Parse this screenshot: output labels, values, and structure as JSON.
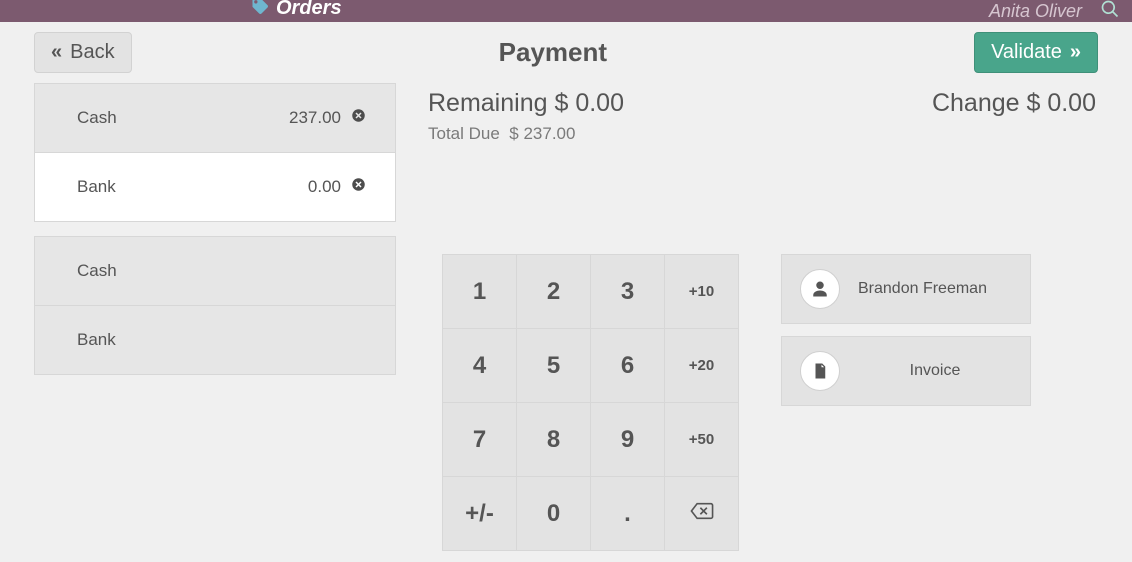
{
  "topbar": {
    "section": "Orders",
    "user": "Anita Oliver"
  },
  "toolbar": {
    "back_label": "Back",
    "title": "Payment",
    "validate_label": "Validate"
  },
  "paylines": [
    {
      "name": "Cash",
      "amount": "237.00",
      "active": false
    },
    {
      "name": "Bank",
      "amount": "0.00",
      "active": true
    }
  ],
  "paymethods": [
    {
      "name": "Cash"
    },
    {
      "name": "Bank"
    }
  ],
  "summary": {
    "remaining_label": "Remaining",
    "remaining_value": "$ 0.00",
    "change_label": "Change",
    "change_value": "$ 0.00",
    "total_due_label": "Total Due",
    "total_due_value": "$ 237.00"
  },
  "numpad": {
    "k1": "1",
    "k2": "2",
    "k3": "3",
    "p10": "+10",
    "k4": "4",
    "k5": "5",
    "k6": "6",
    "p20": "+20",
    "k7": "7",
    "k8": "8",
    "k9": "9",
    "p50": "+50",
    "pm": "+/-",
    "k0": "0",
    "dot": "."
  },
  "customer": {
    "name": "Brandon Freeman"
  },
  "invoice": {
    "label": "Invoice"
  }
}
